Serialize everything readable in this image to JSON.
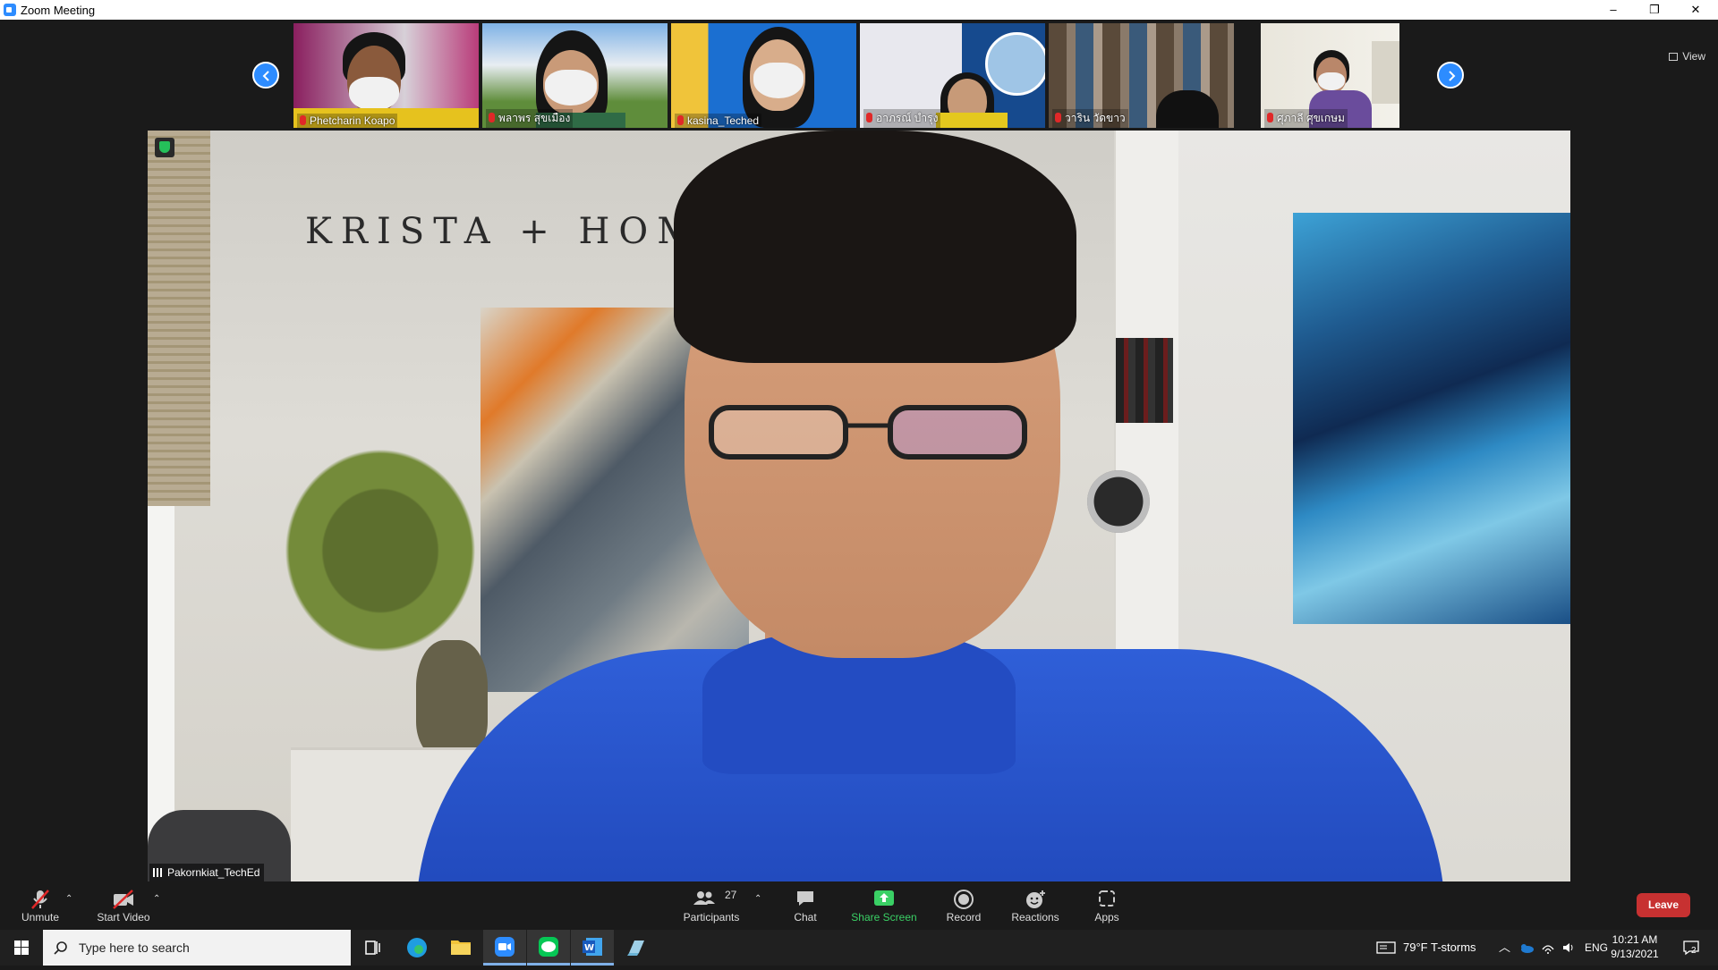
{
  "window": {
    "title": "Zoom Meeting",
    "minimize": "–",
    "restore": "❐",
    "close": "✕"
  },
  "thumbnails": [
    {
      "name": "Phetcharin Koapo"
    },
    {
      "name": "พลาพร สุขเมือง"
    },
    {
      "name": "kasina_Teched"
    },
    {
      "name": "อาภรณ์ บำรุง"
    },
    {
      "name": "วาริน วัดขาว"
    },
    {
      "name": "ศุภาลี ศุขเกษม"
    }
  ],
  "view_button": {
    "label": "View"
  },
  "main_video": {
    "speaker_name": "Pakornkiat_TechEd",
    "wall_text": "KRISTA + HOM"
  },
  "toolbar": {
    "unmute": "Unmute",
    "start_video": "Start Video",
    "participants": "Participants",
    "participants_count": "27",
    "chat": "Chat",
    "share_screen": "Share Screen",
    "record": "Record",
    "reactions": "Reactions",
    "apps": "Apps",
    "leave": "Leave"
  },
  "taskbar": {
    "search_placeholder": "Type here to search",
    "weather": "79°F  T-storms",
    "language": "ENG",
    "time": "10:21 AM",
    "date": "9/13/2021",
    "notifications": "2"
  },
  "colors": {
    "accent": "#2d8cff",
    "leave": "#c73131",
    "share": "#3ad065"
  }
}
